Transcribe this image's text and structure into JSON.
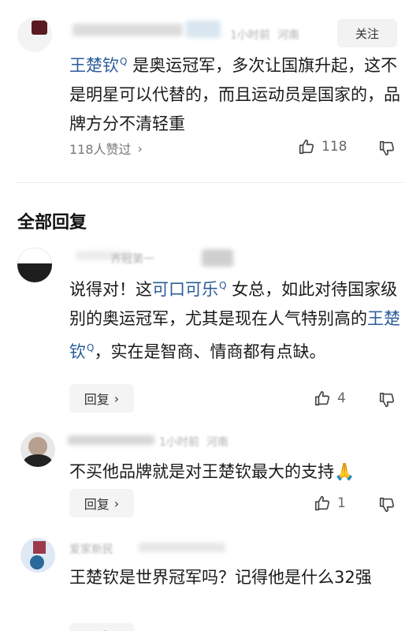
{
  "top_comment": {
    "follow_label": "关注",
    "text_link": "王楚钦",
    "text_rest": "是奥运冠军，多次让国旗升起，这不是明星可以代替的，而且运动员是国家的，品牌方分不清轻重",
    "likes_summary": "118人赞过",
    "like_count": "118",
    "meta_time": "1小时前",
    "meta_location": "河南"
  },
  "section_title": "全部回复",
  "replies": [
    {
      "username": "齐冠第一",
      "text_a": "说得对！这",
      "text_link1": "可口可乐",
      "text_b": "女总，如此对待国家级别的奥运冠军，尤其是现在人气特别高的",
      "text_link2": "王楚钦",
      "text_c": "，实在是智商、情商都有点缺。",
      "reply_label": "回复",
      "like_count": "4"
    },
    {
      "meta_time": "1小时前",
      "meta_location": "河南",
      "text": "不买他品牌就是对王楚钦最大的支持",
      "emoji": "🙏",
      "reply_label": "回复",
      "like_count": "1"
    },
    {
      "username": "爱家新民",
      "text": "王楚钦是世界冠军吗？记得他是什么32强",
      "reply_label": "回复"
    }
  ],
  "colors": {
    "link": "#2b5c9a",
    "text": "#1a1a1a",
    "muted": "#777777"
  }
}
